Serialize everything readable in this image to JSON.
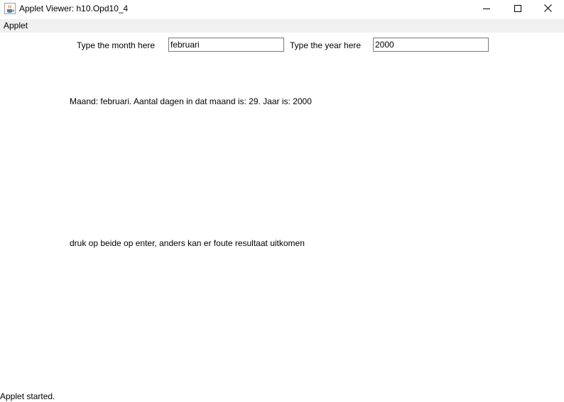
{
  "window": {
    "title": "Applet Viewer: h10.Opd10_4",
    "icon": "java-coffee-cup-icon"
  },
  "menu": {
    "items": [
      "Applet"
    ]
  },
  "form": {
    "month_label": "Type the month here",
    "month_value": "februari",
    "year_label": "Type the year here",
    "year_value": "2000"
  },
  "output": {
    "result": "Maand: februari. Aantal dagen in dat maand is: 29. Jaar is: 2000",
    "hint": "druk op beide op enter, anders kan er foute resultaat uitkomen"
  },
  "statusbar": {
    "text": "Applet started."
  }
}
